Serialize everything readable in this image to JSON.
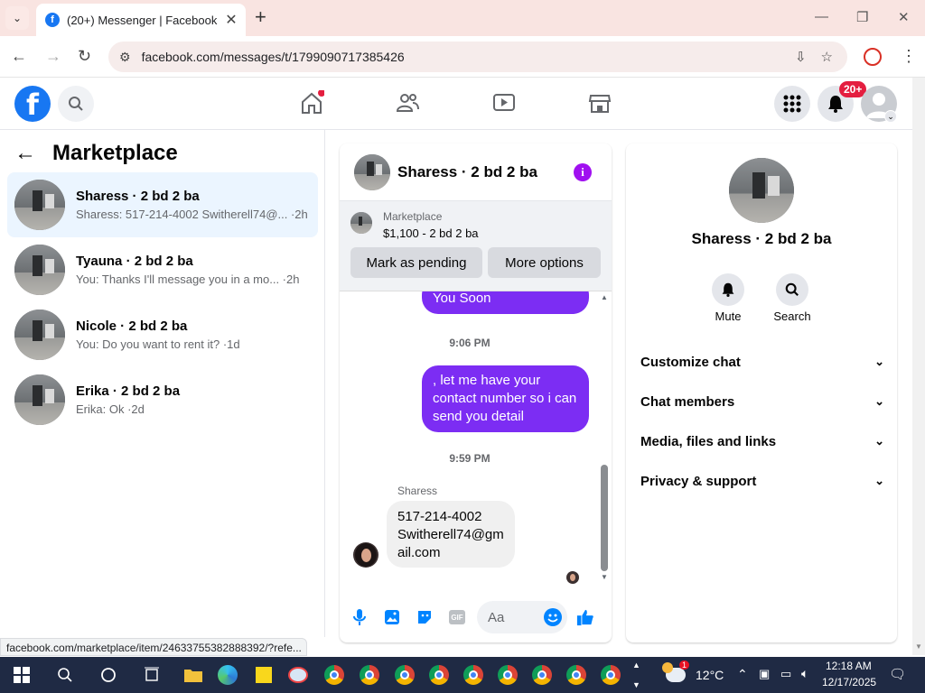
{
  "browser": {
    "tab_title": "(20+) Messenger | Facebook",
    "url": "facebook.com/messages/t/1799090717385426",
    "status_url": "facebook.com/marketplace/item/2463375538288839​2/?refe..."
  },
  "fb_header": {
    "notification_badge": "20+"
  },
  "left_panel": {
    "title": "Marketplace",
    "conversations": [
      {
        "name": "Sharess · 2 bd 2 ba",
        "snippet": "Sharess: 517-214-4002 Switherell74@... ·2h",
        "active": true
      },
      {
        "name": "Tyauna · 2 bd 2 ba",
        "snippet": "You: Thanks I'll message you in a mo... ·2h",
        "active": false
      },
      {
        "name": "Nicole · 2 bd 2 ba",
        "snippet": "You: Do you want to rent it? ·1d",
        "active": false
      },
      {
        "name": "Erika · 2 bd 2 ba",
        "snippet": "Erika: Ok ·2d",
        "active": false
      }
    ]
  },
  "chat": {
    "title": "Sharess · 2 bd 2 ba",
    "listing_label": "Marketplace",
    "listing_price": "$1,100 - 2 bd 2 ba",
    "mark_pending": "Mark as pending",
    "more_options": "More options",
    "messages": {
      "out_1": "You Soon",
      "time_1": "9:06 PM",
      "out_2_line1": ", let me have your",
      "out_2_line2": "contact number so i can",
      "out_2_line3": "send you detail",
      "time_2": "9:59 PM",
      "sender": "Sharess",
      "in_1_line1": "517-214-4002",
      "in_1_line2": "Switherell74@gm",
      "in_1_line3": "ail.com"
    },
    "composer_placeholder": "Aa",
    "gif_label": "GIF"
  },
  "right_panel": {
    "name": "Sharess · 2 bd 2 ba",
    "mute": "Mute",
    "search": "Search",
    "rows": [
      "Customize chat",
      "Chat members",
      "Media, files and links",
      "Privacy & support"
    ]
  },
  "taskbar": {
    "temperature": "12°C",
    "time": "12:18 AM",
    "date": "12/17/2025",
    "weather_badge": "1"
  },
  "colors": {
    "fb_blue": "#1877f2",
    "messenger_purple": "#7c2df3",
    "active_row": "#ebf5ff",
    "badge_red": "#e41e3f"
  }
}
